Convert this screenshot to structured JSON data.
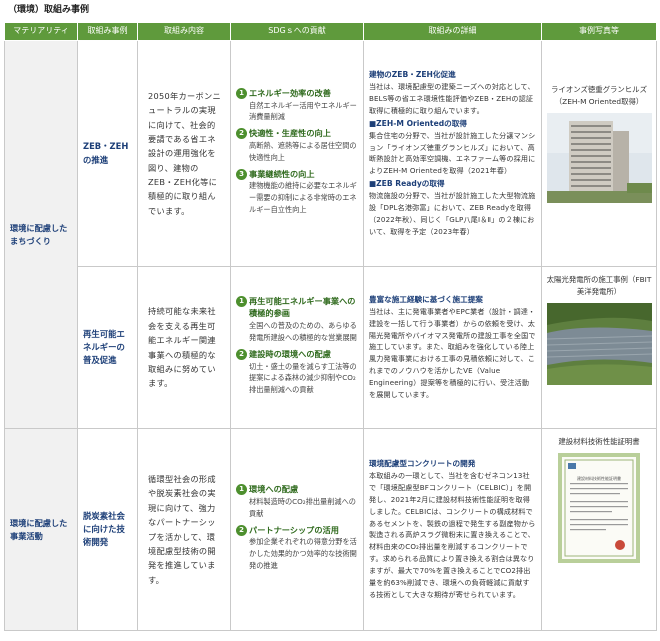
{
  "page_title": "（環境）取組み事例",
  "headers": [
    "マテリアリティ",
    "取組み事例",
    "取組み内容",
    "SDGｓへの貢献",
    "取組みの詳細",
    "事例写真等"
  ],
  "rows": [
    {
      "materiality": "環境に配慮したまちづくり",
      "case": "ZEB・ZEHの推進",
      "content": "2050年カーボンニュートラルの実現に向けて、社会的要請である省エネ設計の運用強化を図り、建物のZEB・ZEH化等に積極的に取り組んでいます。",
      "sdgs": [
        {
          "num": "1",
          "title": "エネルギー効率の改善",
          "desc": "自然エネルギー活用やエネルギー消費量削減"
        },
        {
          "num": "2",
          "title": "快適性・生産性の向上",
          "desc": "高断熱、遮熱等による居住空間の快適性向上"
        },
        {
          "num": "3",
          "title": "事業継続性の向上",
          "desc": "建物機能の維持に必要なエネルギー需要の抑制による非常時のエネルギー自立性向上"
        }
      ],
      "details": [
        {
          "head": "建物のZEB・ZEH化促進",
          "body": "当社は、環境配慮型の建築ニーズへの対応として、BELS等の省エネ環境性能評価やZEB・ZEHの認証取得に積極的に取り組んでいます。"
        },
        {
          "head": "■ZEH-M Orientedの取得",
          "body": "集合住宅の分野で、当社が設計施工した分譲マンション「ライオンズ徳重グランヒルズ」において、高断熱設計と高効率空調機、エネファーム等の採用によりZEH-M Orientedを取得（2021年春）"
        },
        {
          "head": "■ZEB Readyの取得",
          "body": "物流施設の分野で、当社が設計施工した大型物流施設「DPL名港弥富」において、ZEB Readyを取得（2022年秋）、同じく「GLP八尾Ⅰ＆Ⅱ」の２棟において、取得を予定（2023年春）"
        }
      ],
      "photo_caption": "ライオンズ徳重グランヒルズ（ZEH-M Oriented取得）"
    },
    {
      "materiality": "",
      "case": "再生可能エネルギーの普及促進",
      "content": "持続可能な未来社会を支える再生可能エネルギー関連事業への積極的な取組みに努めています。",
      "sdgs": [
        {
          "num": "1",
          "title": "再生可能エネルギー事業への積極的参画",
          "desc": "全国への普及のための、あらゆる発電所建設への積極的な営業展開"
        },
        {
          "num": "2",
          "title": "建設時の環境への配慮",
          "desc": "切土・盛土の量を減らす工法等の提案による森林の減少抑制やCO₂排出量削減への貢献"
        }
      ],
      "details": [
        {
          "head": "豊富な施工経験に基づく施工提案",
          "body": "当社は、主に発電事業者やEPC業者（設計・調達・建設を一括して行う事業者）からの依頼を受け、太陽光発電所やバイオマス発電所の建設工事を全国で施工しています。また、取組みを強化している陸上風力発電事業における工事の見積依頼に対して、これまでのノウハウを活かしたVE（Value Engineering）提案等を積極的に行い、受注活動を展開しています。"
        }
      ],
      "photo_caption": "太陽光発電所の施工事例（FBIT美洋発電所）"
    },
    {
      "materiality": "環境に配慮した事業活動",
      "case": "脱炭素社会に向けた技術開発",
      "content": "循環型社会の形成や脱炭素社会の実現に向けて、強力なパートナーシップを活かして、環境配慮型技術の開発を推進しています。",
      "sdgs": [
        {
          "num": "1",
          "title": "環境への配慮",
          "desc": "材料製造時のCO₂排出量削減への貢献"
        },
        {
          "num": "2",
          "title": "パートナーシップの活用",
          "desc": "参加企業それぞれの得意分野を活かした効果的かつ効率的な技術開発の推進"
        }
      ],
      "details": [
        {
          "head": "環境配慮型コンクリートの開発",
          "body": "本取組みの一環として、当社を含むゼネコン13社で「環境配慮型BFコンクリート（CELBIC）」を開発し、2021年2月に建設材料技術性能証明を取得しました。CELBICは、コンクリートの構成材料であるセメントを、製鉄の過程で発生する副産物から製造される高炉スラグ微粉末に置き換えることで、材料由来のCO₂排出量を削減するコンクリートです。求められる品質により置き換える割合は異なりますが、最大で70%を置き換えることでCO2排出量を約63%削減でき、環境への負荷軽減に貢献する技術として大きな期待が寄せられています。"
        }
      ],
      "photo_caption": "建設材料技術性能証明書",
      "certificate_title": "建設材料技術性能証明書"
    }
  ],
  "colors": {
    "header_bg": "#5f9a3c",
    "accent_green": "#2f6a1d",
    "accent_blue": "#1d3f78"
  }
}
